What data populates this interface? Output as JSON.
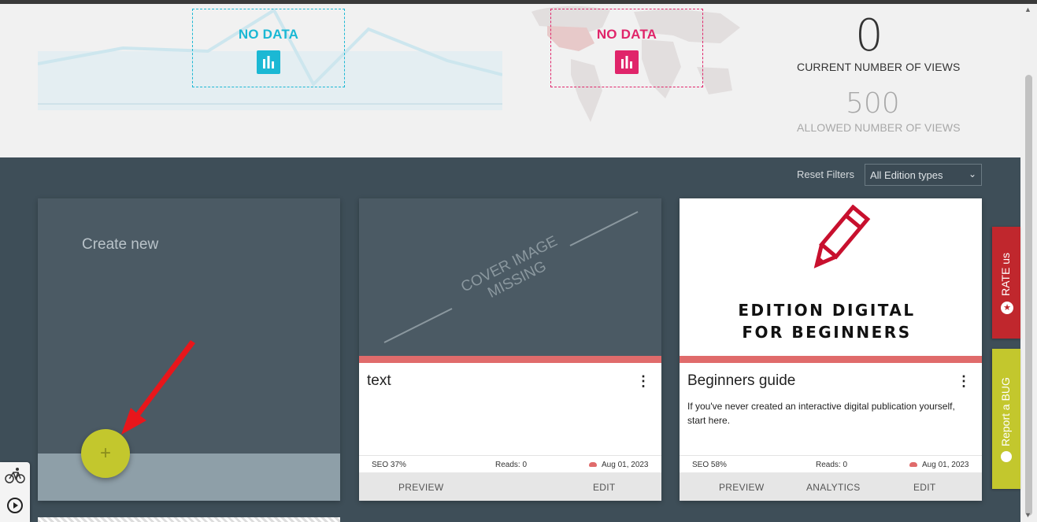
{
  "stats": {
    "chart_no_data_label": "NO DATA",
    "map_no_data_label": "NO DATA",
    "current_views_value": "0",
    "current_views_label": "CURRENT NUMBER OF VIEWS",
    "allowed_views_value": "500",
    "allowed_views_label": "ALLOWED NUMBER OF VIEWS",
    "colors": {
      "chart_accent": "#1bb8d4",
      "map_accent": "#e0256a"
    }
  },
  "filters": {
    "reset_label": "Reset Filters",
    "edition_type_selected": "All Edition types"
  },
  "create_card": {
    "title": "Create new",
    "add_symbol": "+"
  },
  "editions": [
    {
      "cover_placeholder_line1": "COVER IMAGE",
      "cover_placeholder_line2": "MISSING",
      "title": "text",
      "description": "",
      "seo": "SEO 37%",
      "reads": "Reads: 0",
      "date": "Aug 01, 2023",
      "actions": [
        "PREVIEW",
        "EDIT"
      ]
    },
    {
      "cover_line1": "EDITION DIGITAL",
      "cover_line2": "FOR BEGINNERS",
      "title": "Beginners guide",
      "description": "If you've never created an interactive digital publication yourself, start here.",
      "seo": "SEO 58%",
      "reads": "Reads: 0",
      "date": "Aug 01, 2023",
      "actions": [
        "PREVIEW",
        "ANALYTICS",
        "EDIT"
      ]
    }
  ],
  "side_tabs": {
    "rate_label": "RATE us",
    "bug_label": "Report a BUG",
    "colors": {
      "rate": "#c0272d",
      "bug": "#c3c72d"
    }
  },
  "icons": [
    "bar-chart-icon",
    "pencil-icon",
    "kebab-menu-icon",
    "cloud-icon",
    "star-icon",
    "bug-icon",
    "bicycle-icon",
    "play-icon",
    "chevron-down-icon"
  ]
}
